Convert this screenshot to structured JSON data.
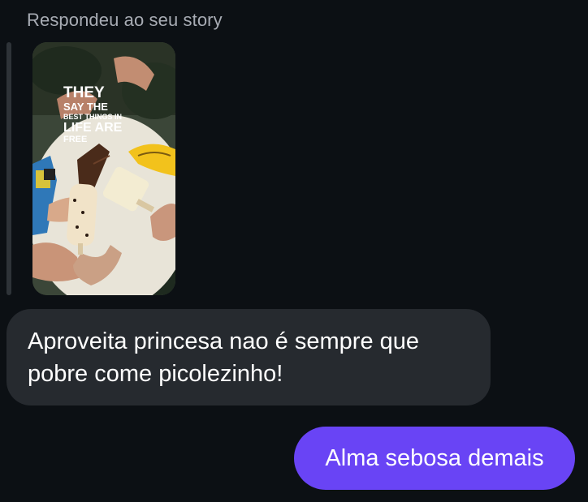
{
  "reply_context": {
    "label": "Respondeu ao seu story",
    "story": {
      "line1": "THEY",
      "line2": "SAY THE",
      "line3": "BEST THINGS IN",
      "line4": "LIFE ARE",
      "line5": "FREE"
    }
  },
  "messages": [
    {
      "direction": "incoming",
      "text": "Aproveita princesa nao é sempre que pobre come picolezinho!"
    },
    {
      "direction": "outgoing",
      "text": "Alma sebosa demais"
    }
  ],
  "colors": {
    "background": "#0c1014",
    "incoming_bubble": "#262a2f",
    "outgoing_bubble": "#6944f5",
    "label_text": "#a8acb4"
  }
}
